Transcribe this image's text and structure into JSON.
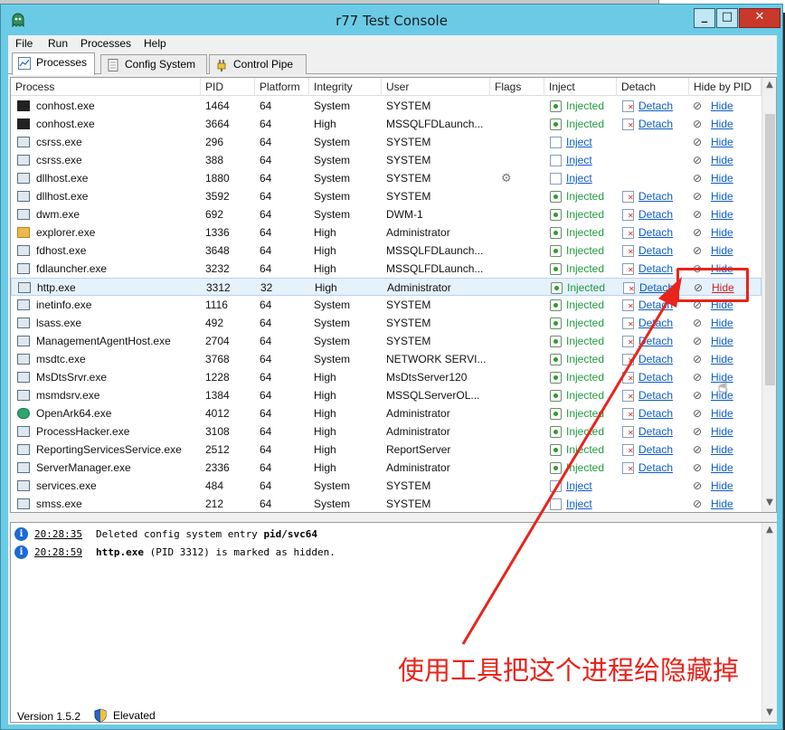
{
  "window": {
    "title": "r77 Test Console",
    "min_label": "_",
    "max_label": "□",
    "close_label": "✕"
  },
  "menu": [
    "File",
    "Run",
    "Processes",
    "Help"
  ],
  "tabs": [
    {
      "label": "Processes",
      "active": true
    },
    {
      "label": "Config System",
      "active": false
    },
    {
      "label": "Control Pipe",
      "active": false
    }
  ],
  "columns": [
    "Process",
    "PID",
    "Platform",
    "Integrity",
    "User",
    "Flags",
    "Inject",
    "Detach",
    "Hide by PID"
  ],
  "processes": [
    {
      "name": "conhost.exe",
      "icon": "console",
      "pid": "1464",
      "platform": "64",
      "integrity": "System",
      "user": "SYSTEM",
      "injected": true,
      "inject_text": "Injected",
      "detach": "Detach",
      "hide": "Hide"
    },
    {
      "name": "conhost.exe",
      "icon": "console",
      "pid": "3664",
      "platform": "64",
      "integrity": "High",
      "user": "MSSQLFDLaunch...",
      "injected": true,
      "inject_text": "Injected",
      "detach": "Detach",
      "hide": "Hide"
    },
    {
      "name": "csrss.exe",
      "icon": "app",
      "pid": "296",
      "platform": "64",
      "integrity": "System",
      "user": "SYSTEM",
      "injected": false,
      "inject_text": "Inject",
      "detach": "",
      "hide": "Hide"
    },
    {
      "name": "csrss.exe",
      "icon": "app",
      "pid": "388",
      "platform": "64",
      "integrity": "System",
      "user": "SYSTEM",
      "injected": false,
      "inject_text": "Inject",
      "detach": "",
      "hide": "Hide"
    },
    {
      "name": "dllhost.exe",
      "icon": "app",
      "pid": "1880",
      "platform": "64",
      "integrity": "System",
      "user": "SYSTEM",
      "injected": false,
      "inject_text": "Inject",
      "detach": "",
      "hide": "Hide",
      "flag": true
    },
    {
      "name": "dllhost.exe",
      "icon": "app",
      "pid": "3592",
      "platform": "64",
      "integrity": "System",
      "user": "SYSTEM",
      "injected": true,
      "inject_text": "Injected",
      "detach": "Detach",
      "hide": "Hide"
    },
    {
      "name": "dwm.exe",
      "icon": "app",
      "pid": "692",
      "platform": "64",
      "integrity": "System",
      "user": "DWM-1",
      "injected": true,
      "inject_text": "Injected",
      "detach": "Detach",
      "hide": "Hide"
    },
    {
      "name": "explorer.exe",
      "icon": "folder",
      "pid": "1336",
      "platform": "64",
      "integrity": "High",
      "user": "Administrator",
      "injected": true,
      "inject_text": "Injected",
      "detach": "Detach",
      "hide": "Hide"
    },
    {
      "name": "fdhost.exe",
      "icon": "app",
      "pid": "3648",
      "platform": "64",
      "integrity": "High",
      "user": "MSSQLFDLaunch...",
      "injected": true,
      "inject_text": "Injected",
      "detach": "Detach",
      "hide": "Hide"
    },
    {
      "name": "fdlauncher.exe",
      "icon": "app",
      "pid": "3232",
      "platform": "64",
      "integrity": "High",
      "user": "MSSQLFDLaunch...",
      "injected": true,
      "inject_text": "Injected",
      "detach": "Detach",
      "hide": "Hide"
    },
    {
      "name": "http.exe",
      "icon": "app",
      "pid": "3312",
      "platform": "32",
      "integrity": "High",
      "user": "Administrator",
      "injected": true,
      "inject_text": "Injected",
      "detach": "Detach",
      "hide": "Hide",
      "selected": true
    },
    {
      "name": "inetinfo.exe",
      "icon": "app",
      "pid": "1116",
      "platform": "64",
      "integrity": "System",
      "user": "SYSTEM",
      "injected": true,
      "inject_text": "Injected",
      "detach": "Detach",
      "hide": "Hide"
    },
    {
      "name": "lsass.exe",
      "icon": "app",
      "pid": "492",
      "platform": "64",
      "integrity": "System",
      "user": "SYSTEM",
      "injected": true,
      "inject_text": "Injected",
      "detach": "Detach",
      "hide": "Hide"
    },
    {
      "name": "ManagementAgentHost.exe",
      "icon": "app",
      "pid": "2704",
      "platform": "64",
      "integrity": "System",
      "user": "SYSTEM",
      "injected": true,
      "inject_text": "Injected",
      "detach": "Detach",
      "hide": "Hide"
    },
    {
      "name": "msdtc.exe",
      "icon": "app",
      "pid": "3768",
      "platform": "64",
      "integrity": "System",
      "user": "NETWORK SERVI...",
      "injected": true,
      "inject_text": "Injected",
      "detach": "Detach",
      "hide": "Hide"
    },
    {
      "name": "MsDtsSrvr.exe",
      "icon": "app",
      "pid": "1228",
      "platform": "64",
      "integrity": "High",
      "user": "MsDtsServer120",
      "injected": true,
      "inject_text": "Injected",
      "detach": "Detach",
      "hide": "Hide"
    },
    {
      "name": "msmdsrv.exe",
      "icon": "app",
      "pid": "1384",
      "platform": "64",
      "integrity": "High",
      "user": "MSSQLServerOL...",
      "injected": true,
      "inject_text": "Injected",
      "detach": "Detach",
      "hide": "Hide"
    },
    {
      "name": "OpenArk64.exe",
      "icon": "green",
      "pid": "4012",
      "platform": "64",
      "integrity": "High",
      "user": "Administrator",
      "injected": true,
      "inject_text": "Injected",
      "detach": "Detach",
      "hide": "Hide"
    },
    {
      "name": "ProcessHacker.exe",
      "icon": "app",
      "pid": "3108",
      "platform": "64",
      "integrity": "High",
      "user": "Administrator",
      "injected": true,
      "inject_text": "Injected",
      "detach": "Detach",
      "hide": "Hide"
    },
    {
      "name": "ReportingServicesService.exe",
      "icon": "app",
      "pid": "2512",
      "platform": "64",
      "integrity": "High",
      "user": "ReportServer",
      "injected": true,
      "inject_text": "Injected",
      "detach": "Detach",
      "hide": "Hide"
    },
    {
      "name": "ServerManager.exe",
      "icon": "app",
      "pid": "2336",
      "platform": "64",
      "integrity": "High",
      "user": "Administrator",
      "injected": true,
      "inject_text": "Injected",
      "detach": "Detach",
      "hide": "Hide"
    },
    {
      "name": "services.exe",
      "icon": "app",
      "pid": "484",
      "platform": "64",
      "integrity": "System",
      "user": "SYSTEM",
      "injected": false,
      "inject_text": "Inject",
      "detach": "",
      "hide": "Hide"
    },
    {
      "name": "smss.exe",
      "icon": "app",
      "pid": "212",
      "platform": "64",
      "integrity": "System",
      "user": "SYSTEM",
      "injected": false,
      "inject_text": "Inject",
      "detach": "",
      "hide": "Hide"
    }
  ],
  "log": [
    {
      "time": "20:28:35",
      "pre": "Deleted config system entry ",
      "bold": "pid/svc64",
      "post": ""
    },
    {
      "time": "20:28:59",
      "pre": "",
      "bold": "http.exe",
      "post": " (PID 3312) is marked as hidden."
    }
  ],
  "status": {
    "version": "Version 1.5.2",
    "elevated": "Elevated"
  },
  "annotation": {
    "text": "使用工具把这个进程给隐藏掉",
    "color": "#e8241b"
  }
}
